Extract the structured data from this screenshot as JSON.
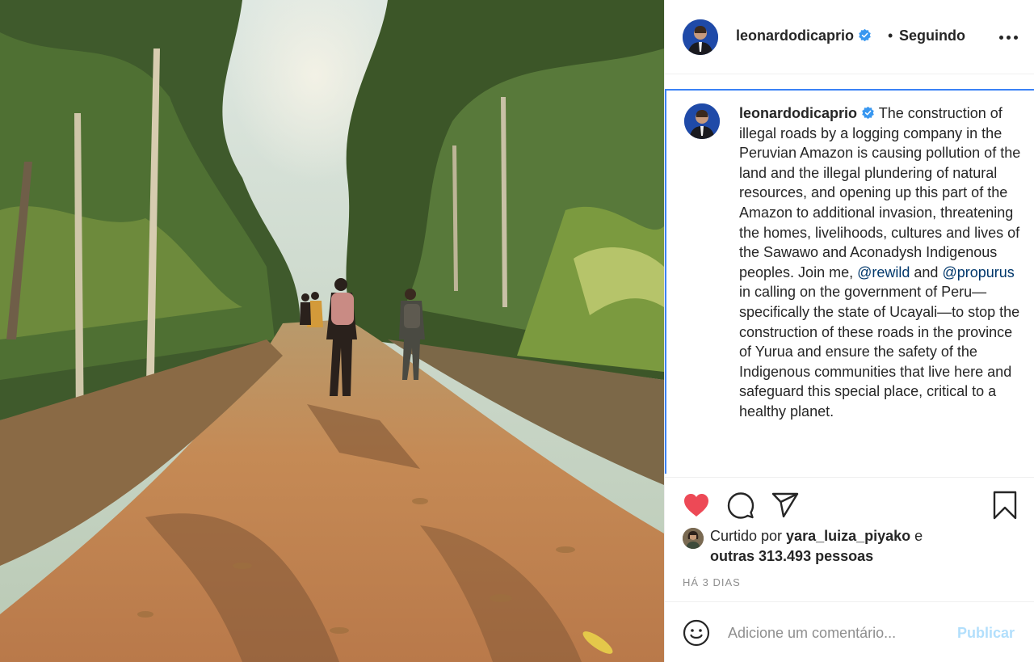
{
  "post": {
    "username": "leonardodicaprio",
    "follow_separator": "•",
    "follow_status": "Seguindo",
    "caption": {
      "username": "leonardodicaprio",
      "text_1": "The construction of illegal roads by a logging company in the Peruvian Amazon is causing pollution of the land and the illegal plundering of natural resources, and opening up this part of the Amazon to additional invasion, threatening the homes, livelihoods, cultures and lives of the Sawawo and Aconadysh Indigenous peoples. Join me, ",
      "mention_1": "@rewild",
      "text_2": " and ",
      "mention_2": "@propurus",
      "text_3": " in calling on the government of Peru—specifically the state of Ucayali—to stop the construction of these roads in the province of Yurua and ensure the safety of the Indigenous communities that live here and safeguard this special place, critical to a healthy planet."
    },
    "likes": {
      "prefix": "Curtido por ",
      "user": "yara_luiza_piyako",
      "connector": " e",
      "others": "outras 313.493 pessoas"
    },
    "date": "HÁ 3 DIAS",
    "comment": {
      "placeholder": "Adicione um comentário...",
      "publish_label": "Publicar"
    }
  },
  "icons": {
    "verified": "verified-badge-icon",
    "more": "more-options-icon",
    "like": "heart-icon",
    "comment": "comment-icon",
    "share": "share-icon",
    "save": "bookmark-icon",
    "emoji": "emoji-icon"
  },
  "colors": {
    "liked_heart": "#ed4956",
    "verified": "#3897f0",
    "mention": "#00376b",
    "publish_disabled": "#b2dffc",
    "muted": "#8e8e8e"
  }
}
